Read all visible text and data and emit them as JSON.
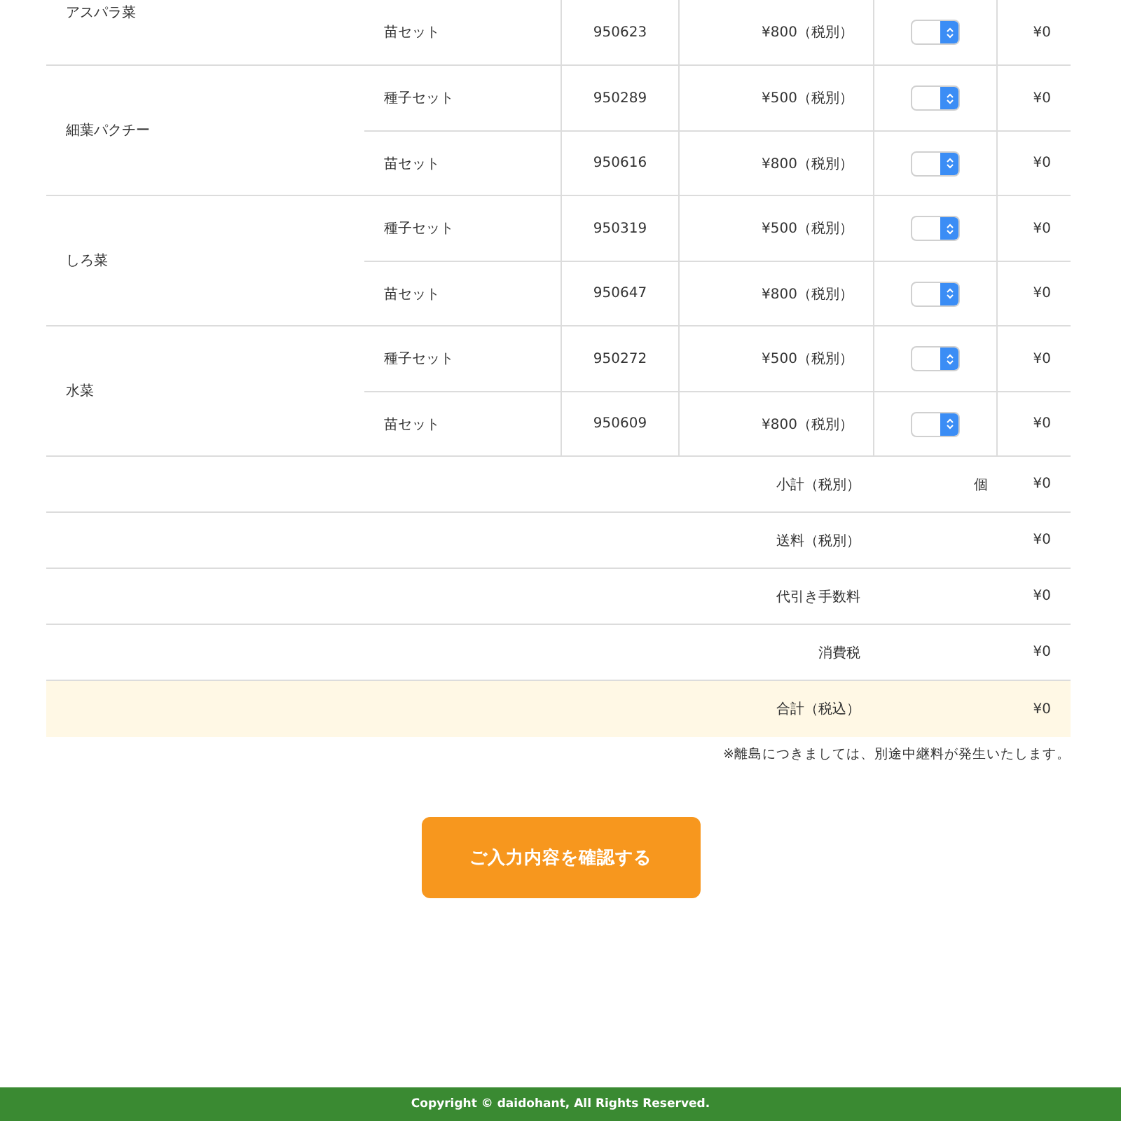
{
  "products": [
    {
      "name": "アスパラ菜",
      "variants": [
        {
          "type": "苗セット",
          "code": "950623",
          "price": "¥800（税別）",
          "amount": "¥0"
        }
      ]
    },
    {
      "name": "細葉パクチー",
      "variants": [
        {
          "type": "種子セット",
          "code": "950289",
          "price": "¥500（税別）",
          "amount": "¥0"
        },
        {
          "type": "苗セット",
          "code": "950616",
          "price": "¥800（税別）",
          "amount": "¥0"
        }
      ]
    },
    {
      "name": "しろ菜",
      "variants": [
        {
          "type": "種子セット",
          "code": "950319",
          "price": "¥500（税別）",
          "amount": "¥0"
        },
        {
          "type": "苗セット",
          "code": "950647",
          "price": "¥800（税別）",
          "amount": "¥0"
        }
      ]
    },
    {
      "name": "水菜",
      "variants": [
        {
          "type": "種子セット",
          "code": "950272",
          "price": "¥500（税別）",
          "amount": "¥0"
        },
        {
          "type": "苗セット",
          "code": "950609",
          "price": "¥800（税別）",
          "amount": "¥0"
        }
      ]
    }
  ],
  "summary": [
    {
      "label": "小計（税別）",
      "unit": "個",
      "value": "¥0",
      "highlighted": false
    },
    {
      "label": "送料（税別）",
      "value": "¥0",
      "highlighted": false
    },
    {
      "label": "代引き手数料",
      "value": "¥0",
      "highlighted": false
    },
    {
      "label": "消費税",
      "value": "¥0",
      "highlighted": false
    },
    {
      "label": "合計（税込）",
      "value": "¥0",
      "highlighted": true
    }
  ],
  "note": "※離島につきましては、別途中継料が発生いたします。",
  "confirm_button": "ご入力内容を確認する",
  "footer": "Copyright © daidohant, All Rights Reserved."
}
